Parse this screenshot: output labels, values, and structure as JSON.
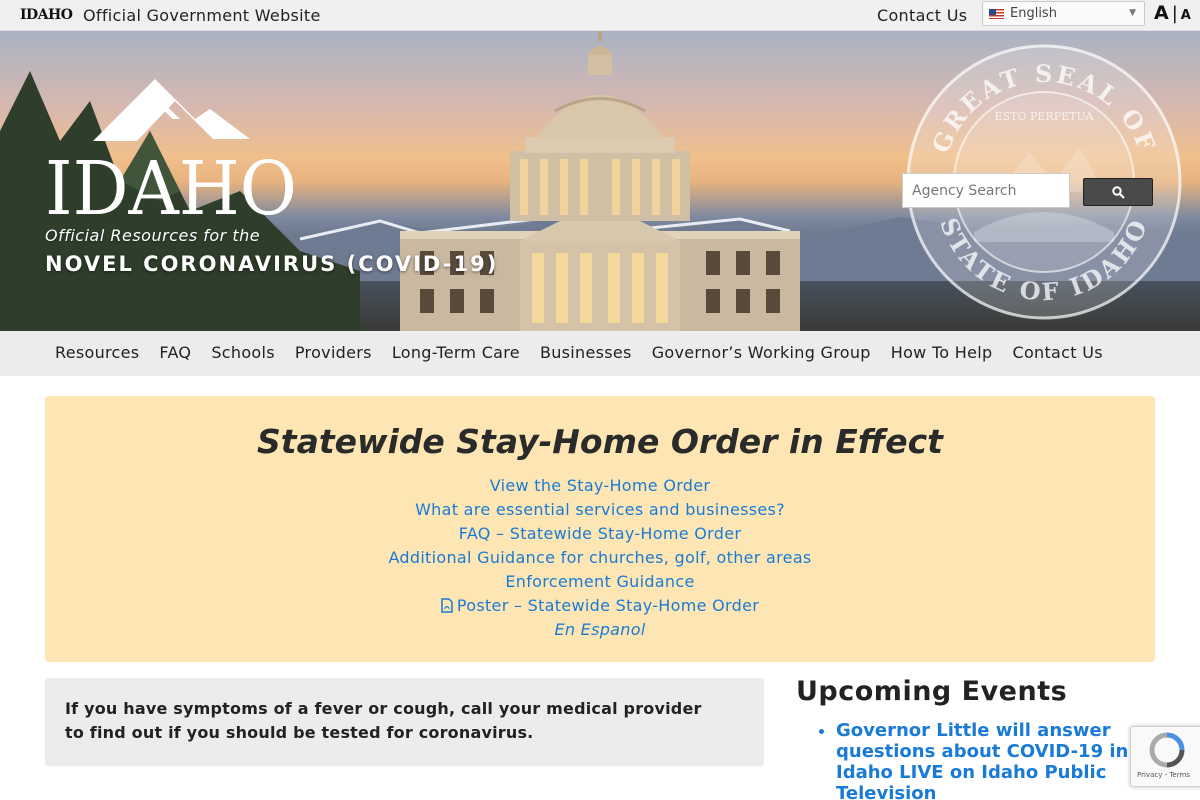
{
  "topbar": {
    "logo_text": "IDAHO",
    "official": "Official Government Website",
    "contact": "Contact Us",
    "language": "English",
    "font_large": "A",
    "font_sep": "|",
    "font_small": "A"
  },
  "hero": {
    "logo_text": "IDAHO",
    "subtitle_italic": "Official Resources for the",
    "subtitle_bold": "NOVEL CORONAVIRUS (COVID-19)",
    "seal_top_text": "GREAT SEAL OF",
    "seal_bottom_text": "STATE OF IDAHO",
    "seal_motto": "ESTO PERPETUA",
    "search_placeholder": "Agency Search"
  },
  "nav": {
    "items": [
      "Resources",
      "FAQ",
      "Schools",
      "Providers",
      "Long-Term Care",
      "Businesses",
      "Governor’s Working Group",
      "How To Help",
      "Contact Us"
    ]
  },
  "alert": {
    "title": "Statewide Stay-Home Order in Effect",
    "links": [
      "View the Stay-Home Order",
      "What are essential services and businesses?",
      "FAQ – Statewide Stay-Home Order",
      "Additional Guidance for churches, golf, other areas",
      "Enforcement Guidance",
      "Poster – Statewide Stay-Home Order",
      "En Espanol"
    ]
  },
  "symptoms": {
    "text": "If you have symptoms of a fever or cough, call your medical provider to find out if you should be tested for coronavirus."
  },
  "events": {
    "title": "Upcoming Events",
    "items": [
      "Governor Little will answer questions about COVID-19 in Idaho LIVE on Idaho Public Television"
    ]
  },
  "recaptcha": {
    "label": "Privacy - Terms"
  },
  "icons": {
    "search": "search-icon",
    "pdf": "pdf-icon",
    "flag": "us-flag-icon",
    "caret": "chevron-down-icon",
    "recaptcha": "recaptcha-icon"
  },
  "colors": {
    "link": "#1a7bd6",
    "alert_bg": "#fde6b3",
    "nav_bg": "#ececec",
    "topbar_bg": "#f0f0f0"
  }
}
